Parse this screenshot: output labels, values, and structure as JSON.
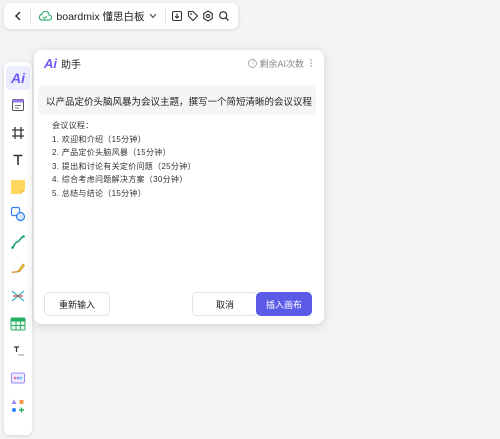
{
  "toolbar": {
    "title": "boardmix 懂思白板",
    "icons": [
      "chevron-left-icon",
      "cloud-icon",
      "chevron-down-icon",
      "download-icon",
      "tag-icon",
      "gear-icon",
      "search-icon"
    ]
  },
  "sidebar": {
    "tools": [
      "ai",
      "sticky-header",
      "frame",
      "text",
      "sticky-note",
      "shapes",
      "pen",
      "brush",
      "mindmap",
      "table",
      "text-card",
      "template",
      "more"
    ]
  },
  "panel": {
    "logo": "Ai",
    "title": "助手",
    "credits_label": "剩余AI次数",
    "prompt": "以产品定价头脑风暴为会议主题，撰写一个简短清晰的会议议程",
    "result_lines": [
      "会议议程：",
      "1.  欢迎和介绍（15分钟）",
      "2.  产品定价头脑风暴（15分钟）",
      "3.  提出和讨论有关定价问题（25分钟）",
      "4.  综合考虑问题解决方案（30分钟）",
      "5.  总结与结论（15分钟）"
    ],
    "retry_label": "重新输入",
    "cancel_label": "取消",
    "insert_label": "插入画布"
  },
  "colors": {
    "accent": "#5b5be8",
    "brand": "#6e5bf5"
  }
}
